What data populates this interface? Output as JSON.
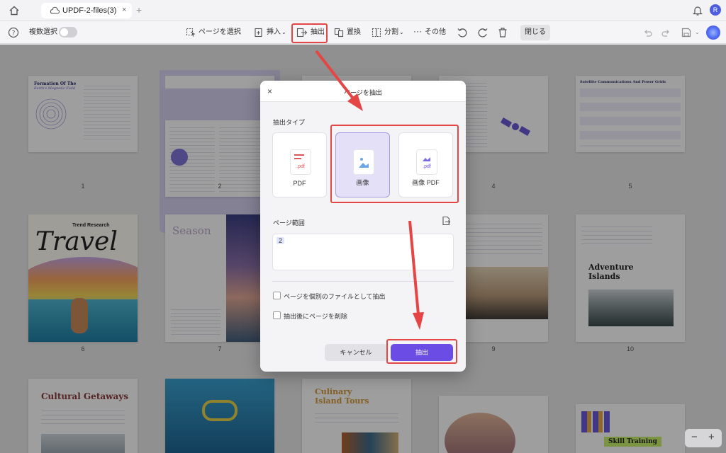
{
  "titlebar": {
    "tab_title": "UPDF-2-files(3)",
    "avatar_letter": "R"
  },
  "toolbar": {
    "multi_select": "複数選択",
    "select_page": "ページを選択",
    "insert": "挿入",
    "extract": "抽出",
    "replace": "置換",
    "split": "分割",
    "more": "その他",
    "close": "閉じる"
  },
  "pages": [
    {
      "num": "1",
      "title": "Formation Of The",
      "subtitle": "Earth's Magnetic Field"
    },
    {
      "num": "2"
    },
    {
      "num": "3"
    },
    {
      "num": "4"
    },
    {
      "num": "5",
      "title": "Satellite Communications And Power Grids"
    },
    {
      "num": "6",
      "title": "Travel",
      "subtitle": "Trend Research"
    },
    {
      "num": "7",
      "title": "Season"
    },
    {
      "num": "8"
    },
    {
      "num": "9"
    },
    {
      "num": "10",
      "title": "Adventure Islands"
    },
    {
      "title": "Cultural Getaways"
    },
    {},
    {
      "title": "Culinary Island Tours"
    },
    {},
    {
      "title": "Skill Training"
    }
  ],
  "dialog": {
    "title": "ページを抽出",
    "extract_type_label": "抽出タイプ",
    "options": [
      {
        "label": "PDF",
        "badge": ".pdf",
        "selected": false
      },
      {
        "label": "画像",
        "selected": true
      },
      {
        "label": "画像 PDF",
        "badge": ".pdf",
        "selected": false
      }
    ],
    "page_range_label": "ページ範囲",
    "page_range_value": "2",
    "checkbox_separate": "ページを個別のファイルとして抽出",
    "checkbox_delete": "抽出後にページを削除",
    "cancel": "キャンセル",
    "extract_button": "抽出"
  },
  "colors": {
    "accent": "#6b4de6",
    "highlight": "#e64545",
    "selected_card": "#e4e0f7"
  }
}
